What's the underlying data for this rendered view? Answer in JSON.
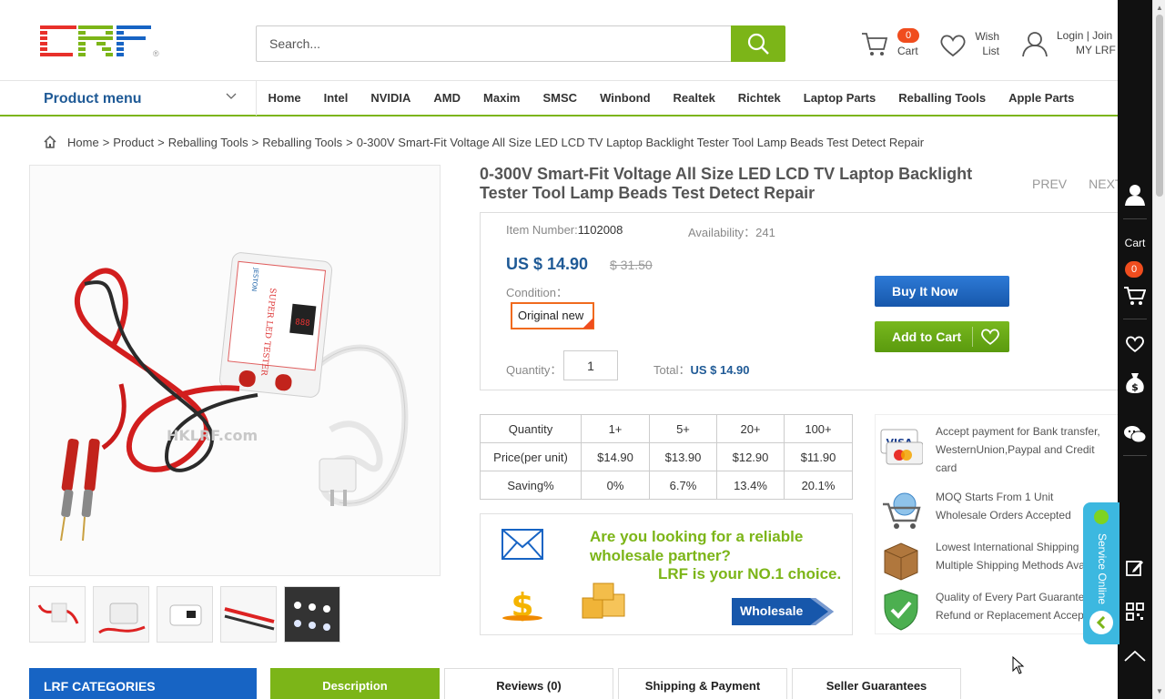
{
  "header": {
    "search_placeholder": "Search...",
    "cart_count": "0",
    "cart_label": "Cart",
    "wish_label": "Wish List",
    "login_join": "Login | Join",
    "my_account": "MY LRF"
  },
  "nav": {
    "product_menu": "Product menu",
    "items": [
      "Home",
      "Intel",
      "NVIDIA",
      "AMD",
      "Maxim",
      "SMSC",
      "Winbond",
      "Realtek",
      "Richtek",
      "Laptop Parts",
      "Reballing Tools",
      "Apple Parts"
    ]
  },
  "breadcrumb": [
    "Home",
    "Product",
    "Reballing Tools",
    "Reballing Tools",
    "0-300V Smart-Fit Voltage All Size LED LCD TV Laptop Backlight Tester Tool Lamp Beads Test Detect Repair"
  ],
  "product": {
    "title": "0-300V Smart-Fit Voltage All Size LED LCD TV Laptop Backlight Tester Tool Lamp Beads Test Detect Repair",
    "prev": "PREV",
    "next": "NEXT",
    "item_number_label": "Item Number:",
    "item_number": "1102008",
    "availability": "Availability：241",
    "price": "US $ 14.90",
    "old_price": "$ 31.50",
    "condition_label": "Condition：",
    "condition_option": "Original new",
    "quantity_label": "Quantity：",
    "quantity": "1",
    "total_label": "Total：",
    "total_value": "US $ 14.90",
    "buy_now": "Buy It Now",
    "add_to_cart": "Add to Cart",
    "image_watermark": "HKLRF.com"
  },
  "price_table": {
    "rows": [
      [
        "Quantity",
        "1+",
        "5+",
        "20+",
        "100+"
      ],
      [
        "Price(per unit)",
        "$14.90",
        "$13.90",
        "$12.90",
        "$11.90"
      ],
      [
        "Saving%",
        "0%",
        "6.7%",
        "13.4%",
        "20.1%"
      ]
    ]
  },
  "wholesale": {
    "question": "Are you looking for a reliable wholesale partner?",
    "answer": "LRF is your NO.1 choice.",
    "button": "Wholesale"
  },
  "guarantees": [
    "Accept payment for Bank transfer, WesternUnion,Paypal and Credit card",
    "MOQ Starts From 1 Unit Wholesale Orders Accepted",
    "Lowest International Shipping Multiple Shipping Methods Available",
    "Quality of Every Part Guaranteed Refund or Replacement Accepted"
  ],
  "bottom": {
    "categories": "LRF CATEGORIES",
    "tabs": [
      "Description",
      "Reviews (0)",
      "Shipping & Payment",
      "Seller Guarantees"
    ]
  },
  "sidebar": {
    "cart_label": "Cart",
    "cart_count": "0",
    "service": "Service Online"
  },
  "colors": {
    "accent_green": "#7cb518",
    "brand_blue": "#1f5a96",
    "badge_orange": "#f04d1e"
  }
}
